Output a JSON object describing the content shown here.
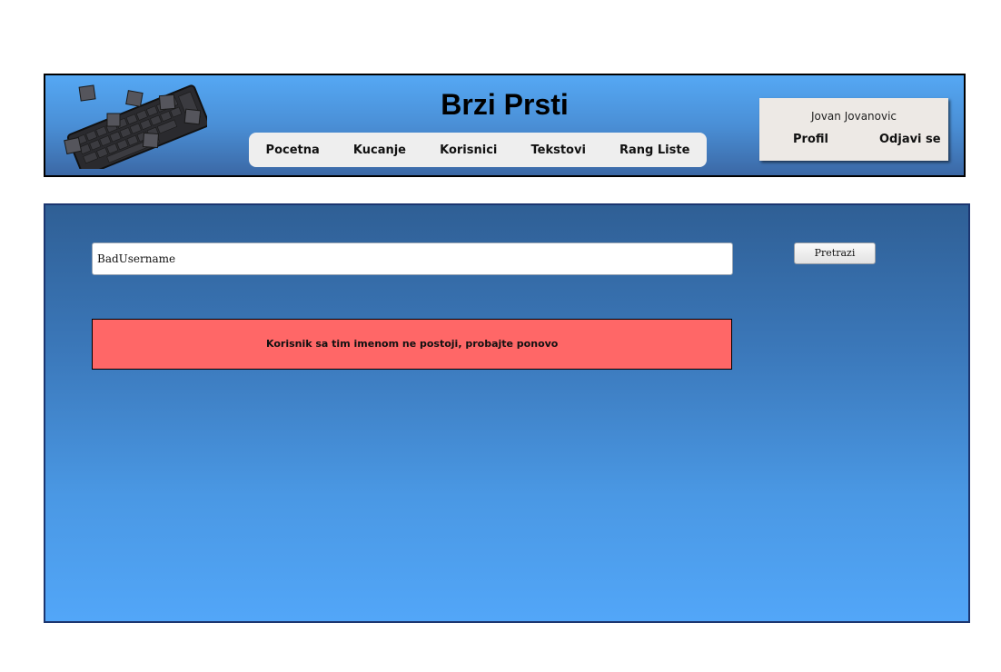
{
  "header": {
    "title": "Brzi Prsti",
    "logo_icon": "keyboard-icon",
    "nav": [
      {
        "label": "Pocetna"
      },
      {
        "label": "Kucanje"
      },
      {
        "label": "Korisnici"
      },
      {
        "label": "Tekstovi"
      },
      {
        "label": "Rang Liste"
      }
    ]
  },
  "user": {
    "name": "Jovan Jovanovic",
    "profile_label": "Profil",
    "logout_label": "Odjavi se"
  },
  "search": {
    "value": "BadUsername",
    "button_label": "Pretrazi"
  },
  "error": {
    "message": "Korisnik sa tim imenom ne postoji, probajte ponovo",
    "color": "#ff6767"
  },
  "colors": {
    "header_top": "#55a8f4",
    "header_bottom": "#3b68a5",
    "main_top": "#2f5f95",
    "main_bottom": "#52a6f8",
    "nav_bg": "#eeeeee",
    "user_box_bg": "#ede9e5"
  }
}
